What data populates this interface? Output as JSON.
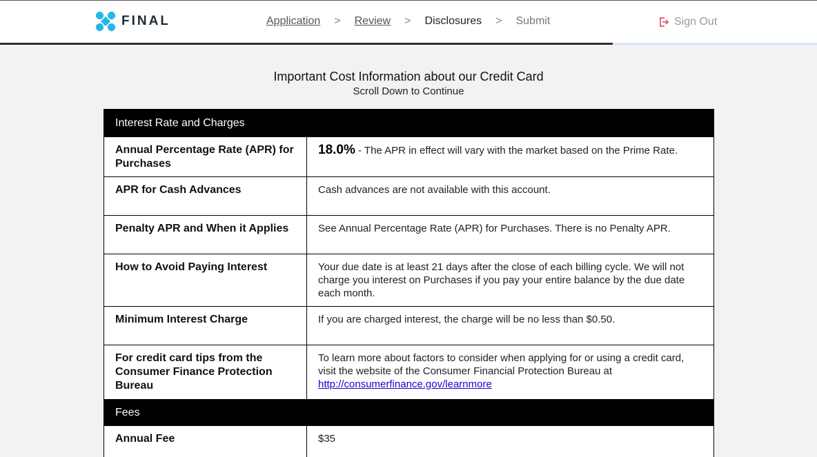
{
  "brand": {
    "name": "FINAL",
    "color": "#29b6e6"
  },
  "nav": {
    "steps": [
      {
        "label": "Application",
        "state": "completed"
      },
      {
        "label": "Review",
        "state": "completed"
      },
      {
        "label": "Disclosures",
        "state": "current"
      },
      {
        "label": "Submit",
        "state": "upcoming"
      }
    ],
    "separator": ">",
    "sign_out": "Sign Out",
    "sign_out_icon": "sign-out-icon",
    "sign_out_icon_color": "#e05a6a"
  },
  "progress": {
    "fraction": 0.75,
    "fill_color": "#26303a",
    "track_color": "#d7e8f6"
  },
  "page": {
    "title": "Important Cost Information about our Credit Card",
    "subtitle": "Scroll Down to Continue"
  },
  "sections": [
    {
      "header": "Interest Rate and Charges",
      "rows": [
        {
          "label": "Annual Percentage Rate (APR) for Purchases",
          "value_emphasis": "18.0%",
          "value": " - The APR in effect will vary with the market based on the Prime Rate."
        },
        {
          "label": "APR for Cash Advances",
          "value": "Cash advances are not available with this account."
        },
        {
          "label": "Penalty APR and When it Applies",
          "value": "See Annual Percentage Rate (APR) for Purchases. There is no Penalty APR."
        },
        {
          "label": "How to Avoid Paying Interest",
          "value": "Your due date is at least 21 days after the close of each billing cycle. We will not charge you interest on Purchases if you pay your entire balance by the due date each month."
        },
        {
          "label": "Minimum Interest Charge",
          "value": "If you are charged interest, the charge will be no less than $0.50."
        },
        {
          "label": "For credit card tips from the Consumer Finance Protection Bureau",
          "value": "To learn more about factors to consider when applying for or using a credit card, visit the website of the Consumer Financial Protection Bureau at ",
          "link": "http://consumerfinance.gov/learnmore"
        }
      ]
    },
    {
      "header": "Fees",
      "rows": [
        {
          "label": "Annual Fee",
          "value": "$35"
        }
      ]
    }
  ]
}
